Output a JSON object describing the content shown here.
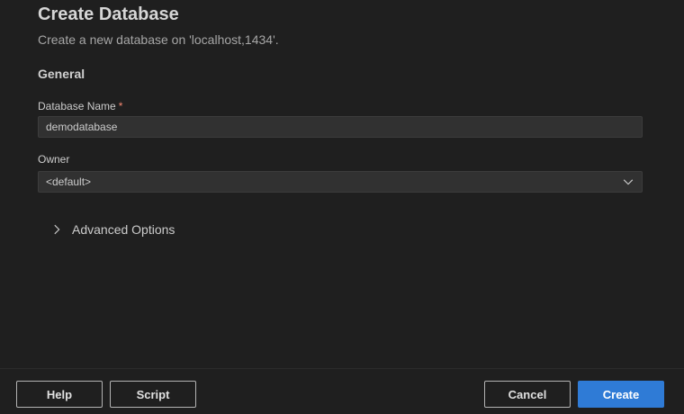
{
  "dialog": {
    "title": "Create Database",
    "subtitle": "Create a new database on 'localhost,1434'."
  },
  "general": {
    "heading": "General",
    "database_name": {
      "label": "Database Name",
      "required_mark": "*",
      "value": "demodatabase"
    },
    "owner": {
      "label": "Owner",
      "selected": "<default>"
    }
  },
  "advanced": {
    "label": "Advanced Options",
    "expanded": false
  },
  "footer": {
    "help_label": "Help",
    "script_label": "Script",
    "cancel_label": "Cancel",
    "create_label": "Create"
  },
  "colors": {
    "background": "#1f1f1f",
    "input_background": "#313131",
    "primary_button": "#2f7bd6",
    "required_mark": "#f48771"
  },
  "icons": {
    "owner_dropdown": "chevron-down-icon",
    "advanced_toggle": "chevron-right-icon"
  }
}
